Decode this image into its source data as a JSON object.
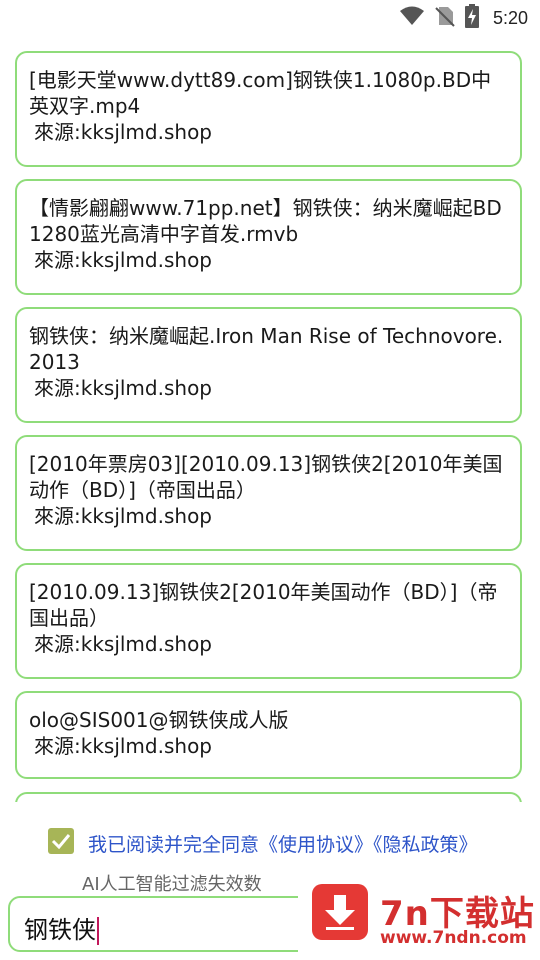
{
  "status_bar": {
    "time": "5:20",
    "icons": [
      "wifi-icon",
      "no-sim-icon",
      "battery-charging-icon"
    ]
  },
  "results": [
    {
      "title": "[电影天堂www.dytt89.com]钢铁侠1.1080p.BD中英双字.mp4",
      "source": "來源:kksjlmd.shop"
    },
    {
      "title": "【情影翩翩www.71pp.net】钢铁侠：纳米魔崛起BD1280蓝光高清中字首发.rmvb",
      "source": "來源:kksjlmd.shop"
    },
    {
      "title": "钢铁侠：纳米魔崛起.Iron Man Rise of Technovore.2013",
      "source": "來源:kksjlmd.shop"
    },
    {
      "title": "[2010年票房03][2010.09.13]钢铁侠2[2010年美国动作（BD）]（帝国出品）",
      "source": "來源:kksjlmd.shop"
    },
    {
      "title": "[2010.09.13]钢铁侠2[2010年美国动作（BD）]（帝国出品）",
      "source": "來源:kksjlmd.shop"
    },
    {
      "title": "olo@SIS001@钢铁侠成人版",
      "source": "來源:kksjlmd.shop"
    }
  ],
  "agreement": {
    "checked": true,
    "text": "我已阅读并完全同意《使用协议》《隐私政策》"
  },
  "filter_note": "AI人工智能过滤失效数",
  "search": {
    "value": "钢铁侠"
  },
  "watermark": {
    "title": "7n下载站",
    "url": "www.7ndn.com"
  },
  "colors": {
    "card_border": "#8fdc7a",
    "checkbox": "#a7b557",
    "link": "#2e55c9",
    "watermark": "#d32f2f"
  }
}
